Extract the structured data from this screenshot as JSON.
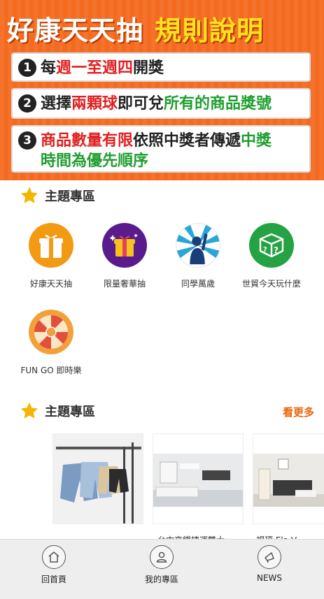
{
  "banner": {
    "title_white": "好康天天抽",
    "title_yellow": "規則說明",
    "rules": [
      {
        "num": "1",
        "parts": [
          "每",
          "週一至週四",
          "開獎"
        ]
      },
      {
        "num": "2",
        "parts": [
          "選擇",
          "兩顆球",
          "即可兌",
          "所有的商品獎號"
        ]
      },
      {
        "num": "3",
        "parts": [
          "商品數量有限",
          "依照中獎者傳遞",
          "中獎",
          "時間為優先順序"
        ]
      }
    ]
  },
  "section1": {
    "title": "主題專區",
    "items": [
      {
        "label": "好康天天抽",
        "icon": "gift-box-icon"
      },
      {
        "label": "限量奢華抽",
        "icon": "luxury-gift-icon"
      },
      {
        "label": "同學萬歲",
        "icon": "cheering-student-icon"
      },
      {
        "label": "世貿今天玩什麼",
        "icon": "mystery-box-icon"
      },
      {
        "label": "FUN GO 即時樂",
        "icon": "prize-wheel-icon"
      }
    ]
  },
  "section2": {
    "title": "主題專區",
    "more": "看更多",
    "cards": [
      {
        "title": "",
        "image": "denim-shorts-rack-photo"
      },
      {
        "title": "台中高鐵捷運雙大...",
        "image": "bedroom-interior-photo"
      },
      {
        "title": "視頂 Ela V...",
        "image": "living-room-interior-photo"
      }
    ]
  },
  "bottom_nav": {
    "items": [
      {
        "label": "回首頁",
        "icon": "home-icon"
      },
      {
        "label": "我的專區",
        "icon": "user-icon"
      },
      {
        "label": "NEWS",
        "icon": "megaphone-icon"
      }
    ]
  },
  "colors": {
    "banner_bg": "#f46a1f",
    "title_yellow": "#ffe11f",
    "accent_red": "#e02020",
    "accent_green": "#1f9e2f",
    "more_orange": "#e8650a",
    "star": "#f5b400"
  }
}
